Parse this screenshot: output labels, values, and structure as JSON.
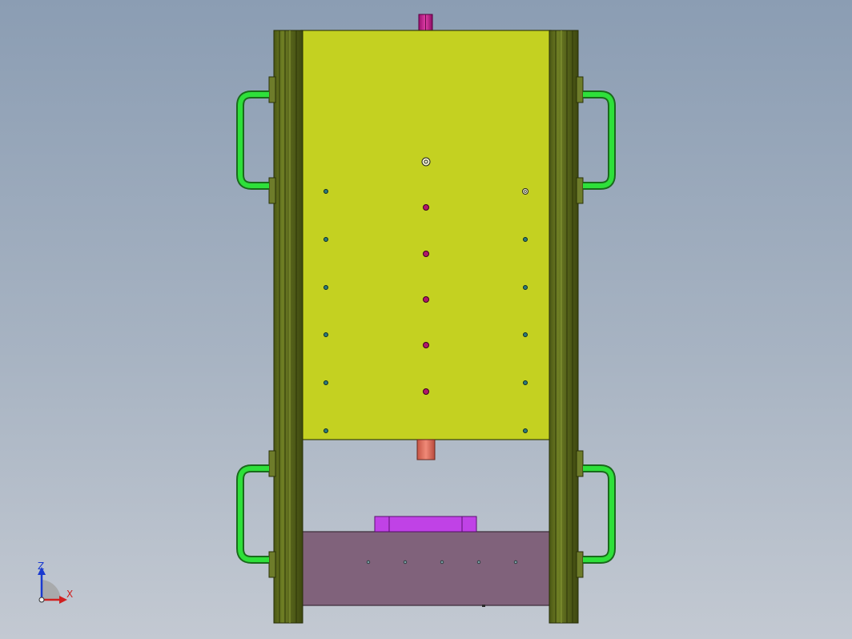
{
  "app": {
    "view": "cad-3d-viewport",
    "background_top": "#8b9db3",
    "background_bottom": "#c3c9d2"
  },
  "model": {
    "top_plate_color": "#c4d121",
    "bottom_plate_color": "#80627b",
    "rail_color": "#5c6a1c",
    "handle_color": "#2ee03a",
    "sprue_color": "#c01b8c",
    "nozzle_color": "#e07060",
    "insert_color": "#c042e6",
    "center_hole_color": "#b0186a",
    "side_hole_color": "#2e7a7a"
  },
  "triad": {
    "z_label": "Z",
    "x_label": "X",
    "z_color": "#1a3ad0",
    "x_color": "#d02020"
  }
}
